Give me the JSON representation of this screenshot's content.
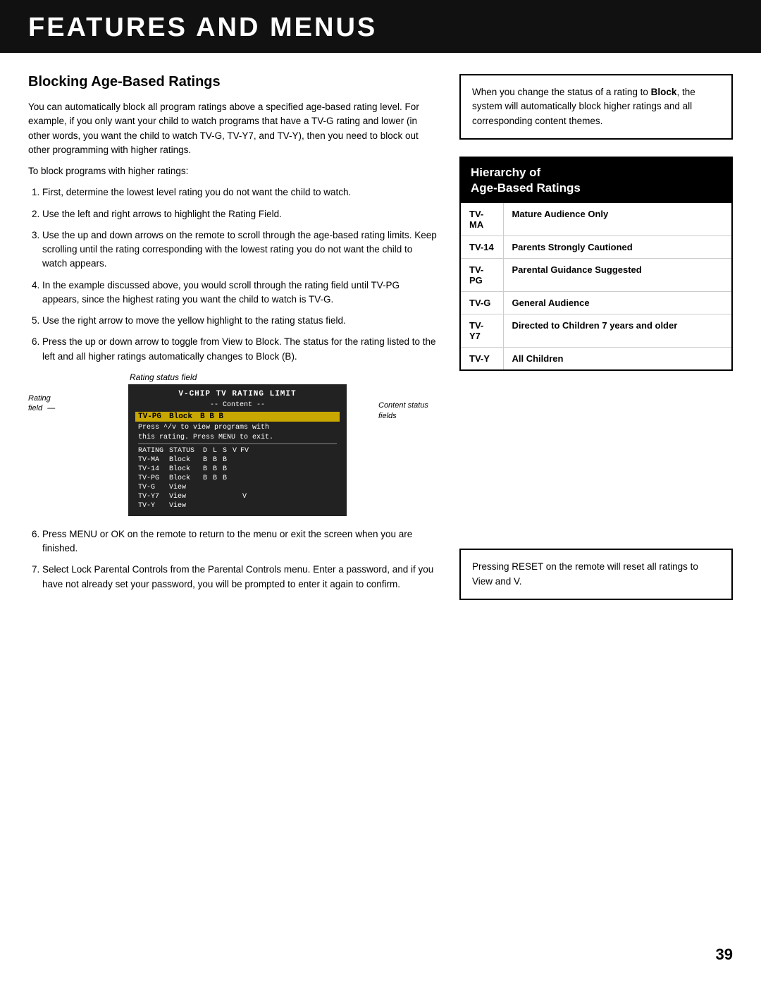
{
  "header": {
    "title": "FEATURES AND MENUS"
  },
  "page_number": "39",
  "left": {
    "section_title": "Blocking Age-Based Ratings",
    "intro_para": "You can automatically block all program ratings above a specified age-based rating level. For example, if you only want your child to watch programs that have a TV-G rating and lower (in other words, you want the child to watch TV-G, TV-Y7, and TV-Y), then you need to block out other programming with higher ratings.",
    "sub_para": "To block programs with higher ratings:",
    "steps": [
      "First, determine the lowest level rating you do not want the child to watch.",
      "Use the left and right arrows to highlight the Rating Field.",
      "Use the up and down arrows on the remote to scroll through the age-based rating limits. Keep scrolling until the rating corresponding with the lowest rating you do not want the child to watch appears.",
      "In the example discussed above, you would scroll through the rating field until TV-PG appears, since the highest rating you want the child to watch is TV-G.",
      "Use the right arrow to move the yellow highlight to the rating status field.",
      "Press the up or down arrow to toggle from View to Block. The status for the rating listed to the left and all higher ratings automatically changes to Block (B).",
      "Press MENU or OK on the remote to return to the menu or exit the screen when you are finished.",
      "Select Lock Parental Controls from the Parental Controls menu. Enter a password, and if you have not already set your password, you will be prompted to enter it again to confirm."
    ],
    "diagram": {
      "label_top": "Rating status field",
      "label_rating_field": "Rating\nfield",
      "label_content": "Content status\nfields",
      "screen": {
        "title": "V-CHIP  TV  RATING  LIMIT",
        "subtitle": "-- Content --",
        "col_header": "RATING    STATUS   D  L  S  V  FV",
        "highlight_rating": "TV-PG",
        "highlight_status": "Block",
        "highlight_cols": "B  B  B",
        "info_line1": "Press ^/v to view programs with",
        "info_line2": "this rating. Press MENU to exit.",
        "rows": [
          {
            "rating": "TV-MA",
            "status": "Block",
            "d": "B",
            "l": "B",
            "s": "B",
            "v": "",
            "fv": ""
          },
          {
            "rating": "TV-14",
            "status": "Block",
            "d": "B",
            "l": "B",
            "s": "B",
            "v": "",
            "fv": ""
          },
          {
            "rating": "TV-PG",
            "status": "Block",
            "d": "B",
            "l": "B",
            "s": "B",
            "v": "",
            "fv": ""
          },
          {
            "rating": "TV-G",
            "status": "View",
            "d": "",
            "l": "",
            "s": "",
            "v": "",
            "fv": ""
          },
          {
            "rating": "TV-Y7",
            "status": "View",
            "d": "",
            "l": "",
            "s": "",
            "v": "",
            "fv": "V"
          },
          {
            "rating": "TV-Y",
            "status": "View",
            "d": "",
            "l": "",
            "s": "",
            "v": "",
            "fv": ""
          }
        ]
      }
    },
    "step6": "Press MENU or OK on the remote to return to the menu or exit the screen when you are finished.",
    "step7": "Select Lock Parental Controls from the Parental Controls menu. Enter a password, and if you have not already set your password, you will be prompted to enter it again to confirm."
  },
  "right": {
    "note_box": {
      "text": "When you change the status of a rating to Block, the system will automatically block higher ratings and all corresponding content themes."
    },
    "hierarchy": {
      "header_line1": "Hierarchy of",
      "header_line2": "Age-Based Ratings",
      "rows": [
        {
          "code": "TV-MA",
          "description": "Mature Audience Only"
        },
        {
          "code": "TV-14",
          "description": "Parents Strongly Cautioned"
        },
        {
          "code": "TV-PG",
          "description": "Parental Guidance Suggested"
        },
        {
          "code": "TV-G",
          "description": "General Audience"
        },
        {
          "code": "TV-Y7",
          "description": "Directed to Children 7 years and older"
        },
        {
          "code": "TV-Y",
          "description": "All Children"
        }
      ]
    },
    "reset_box": {
      "text": "Pressing RESET on the remote will reset all ratings to View and V."
    }
  }
}
